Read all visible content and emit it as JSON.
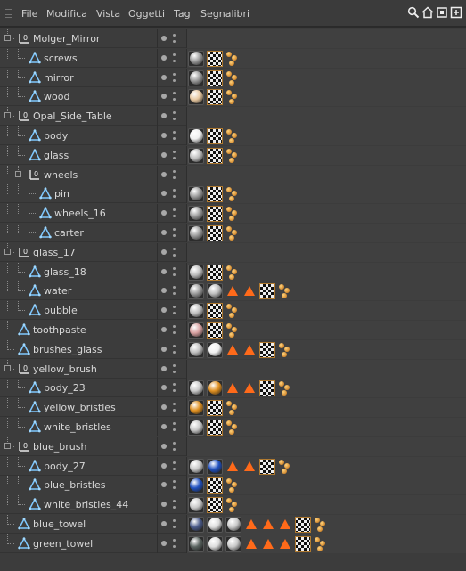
{
  "menu": [
    "File",
    "Modifica",
    "Vista",
    "Oggetti",
    "Tag",
    "Segnalibri"
  ],
  "toolbar_icons": [
    "search-icon",
    "home-icon",
    "frame-icon",
    "new-window-icon"
  ],
  "rows": [
    {
      "name": "Molger_Mirror",
      "kind": "null",
      "depth": 0,
      "tags": []
    },
    {
      "name": "screws",
      "kind": "poly",
      "depth": 1,
      "tags": [
        "mat-chrome",
        "texture",
        "balls"
      ]
    },
    {
      "name": "mirror",
      "kind": "poly",
      "depth": 1,
      "tags": [
        "mat-chrome",
        "texture",
        "balls"
      ]
    },
    {
      "name": "wood",
      "kind": "poly",
      "depth": 1,
      "tags": [
        "mat-wood",
        "texture",
        "balls"
      ]
    },
    {
      "name": "Opal_Side_Table",
      "kind": "null",
      "depth": 0,
      "tags": []
    },
    {
      "name": "body",
      "kind": "poly",
      "depth": 1,
      "tags": [
        "mat-white",
        "texture",
        "balls"
      ]
    },
    {
      "name": "glass",
      "kind": "poly",
      "depth": 1,
      "tags": [
        "mat-glass",
        "texture",
        "balls"
      ]
    },
    {
      "name": "wheels",
      "kind": "null",
      "depth": 1,
      "tags": []
    },
    {
      "name": "pin",
      "kind": "poly",
      "depth": 2,
      "tags": [
        "mat-chrome",
        "texture",
        "balls"
      ]
    },
    {
      "name": "wheels_16",
      "kind": "poly",
      "depth": 2,
      "tags": [
        "mat-chrome",
        "texture",
        "balls"
      ]
    },
    {
      "name": "carter",
      "kind": "poly",
      "depth": 2,
      "tags": [
        "mat-chrome",
        "texture",
        "balls"
      ]
    },
    {
      "name": "glass_17",
      "kind": "null",
      "depth": 0,
      "tags": []
    },
    {
      "name": "glass_18",
      "kind": "poly",
      "depth": 1,
      "tags": [
        "mat-glass",
        "texture",
        "balls"
      ]
    },
    {
      "name": "water",
      "kind": "poly",
      "depth": 1,
      "tags": [
        "mat-chrome",
        "mat-glass",
        "tri",
        "tri",
        "texture",
        "balls"
      ]
    },
    {
      "name": "bubble",
      "kind": "poly",
      "depth": 1,
      "tags": [
        "mat-glass",
        "texture",
        "balls"
      ]
    },
    {
      "name": "toothpaste",
      "kind": "poly",
      "depth": 0,
      "tags": [
        "mat-pink",
        "texture",
        "balls"
      ]
    },
    {
      "name": "brushes_glass",
      "kind": "poly",
      "depth": 0,
      "tags": [
        "mat-glass",
        "mat-white",
        "tri",
        "tri",
        "texture",
        "balls"
      ]
    },
    {
      "name": "yellow_brush",
      "kind": "null",
      "depth": 0,
      "tags": []
    },
    {
      "name": "body_23",
      "kind": "poly",
      "depth": 1,
      "tags": [
        "mat-grey",
        "mat-orange",
        "tri",
        "tri",
        "texture",
        "balls"
      ]
    },
    {
      "name": "yellow_bristles",
      "kind": "poly",
      "depth": 1,
      "tags": [
        "mat-orange",
        "texture",
        "balls"
      ]
    },
    {
      "name": "white_bristles",
      "kind": "poly",
      "depth": 1,
      "tags": [
        "mat-grey",
        "texture",
        "balls"
      ]
    },
    {
      "name": "blue_brush",
      "kind": "null",
      "depth": 0,
      "tags": []
    },
    {
      "name": "body_27",
      "kind": "poly",
      "depth": 1,
      "tags": [
        "mat-grey",
        "mat-blue",
        "tri",
        "tri",
        "texture",
        "balls"
      ]
    },
    {
      "name": "blue_bristles",
      "kind": "poly",
      "depth": 1,
      "tags": [
        "mat-blue",
        "texture",
        "balls"
      ]
    },
    {
      "name": "white_bristles_44",
      "kind": "poly",
      "depth": 1,
      "tags": [
        "mat-grey",
        "texture",
        "balls"
      ]
    },
    {
      "name": "blue_towel",
      "kind": "poly",
      "depth": 0,
      "tags": [
        "mat-navy",
        "mat-stripe",
        "mat-grey",
        "tri",
        "tri",
        "tri",
        "texture",
        "balls"
      ]
    },
    {
      "name": "green_towel",
      "kind": "poly",
      "depth": 0,
      "tags": [
        "mat-darkgreen",
        "mat-stripe",
        "mat-grey",
        "tri",
        "tri",
        "tri",
        "texture",
        "balls"
      ]
    }
  ],
  "colors": {
    "mat-chrome": "#9a9a9a",
    "mat-wood": "#e8c8a0",
    "mat-white": "#f0f0f0",
    "mat-glass": "#bdbdbd",
    "mat-pink": "#d8a0a0",
    "mat-grey": "#c8c8c8",
    "mat-orange": "#e09020",
    "mat-blue": "#2050c0",
    "mat-navy": "#4a5a8a",
    "mat-stripe": "#dcdcdc",
    "mat-darkgreen": "#5a6460",
    "tag-triangle": "#ff6a1a",
    "texture-frame": "#b07a30"
  }
}
